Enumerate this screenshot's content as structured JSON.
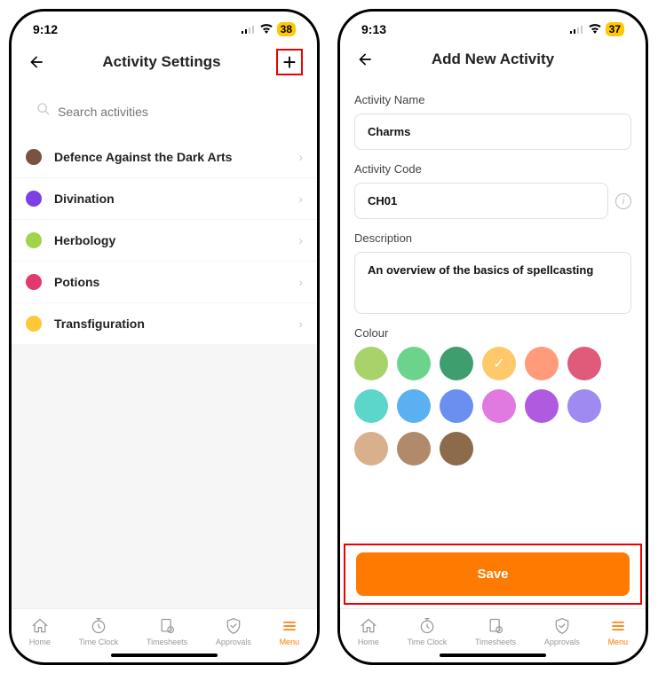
{
  "statusBar": {
    "timeLeft": "9:12",
    "timeRight": "9:13",
    "batteryLeft": "38",
    "batteryRight": "37"
  },
  "screenLeft": {
    "title": "Activity Settings",
    "searchPlaceholder": "Search activities",
    "activities": [
      {
        "label": "Defence Against the Dark Arts",
        "color": "#7a5241"
      },
      {
        "label": "Divination",
        "color": "#7b3fe4"
      },
      {
        "label": "Herbology",
        "color": "#a0d34a"
      },
      {
        "label": "Potions",
        "color": "#e23a6e"
      },
      {
        "label": "Transfiguration",
        "color": "#ffc838"
      }
    ]
  },
  "screenRight": {
    "title": "Add New Activity",
    "labels": {
      "name": "Activity Name",
      "code": "Activity Code",
      "desc": "Description",
      "colour": "Colour"
    },
    "values": {
      "name": "Charms",
      "code": "CH01",
      "desc": "An overview of the basics of spellcasting"
    },
    "palette": [
      {
        "c": "#a8d36b"
      },
      {
        "c": "#6bd38c"
      },
      {
        "c": "#3f9e6e"
      },
      {
        "c": "#ffc96b",
        "selected": true
      },
      {
        "c": "#ff9a7a"
      },
      {
        "c": "#e05a7a"
      },
      {
        "c": "#5cd6c8"
      },
      {
        "c": "#5ab0f0"
      },
      {
        "c": "#6b8ff0"
      },
      {
        "c": "#e07ae0"
      },
      {
        "c": "#b05ae0"
      },
      {
        "c": "#9e8af0"
      },
      {
        "c": "#d9b08c"
      },
      {
        "c": "#b08a6b"
      },
      {
        "c": "#8c6b4a"
      }
    ],
    "saveLabel": "Save"
  },
  "nav": {
    "items": [
      {
        "label": "Home"
      },
      {
        "label": "Time Clock"
      },
      {
        "label": "Timesheets"
      },
      {
        "label": "Approvals"
      },
      {
        "label": "Menu"
      }
    ]
  }
}
